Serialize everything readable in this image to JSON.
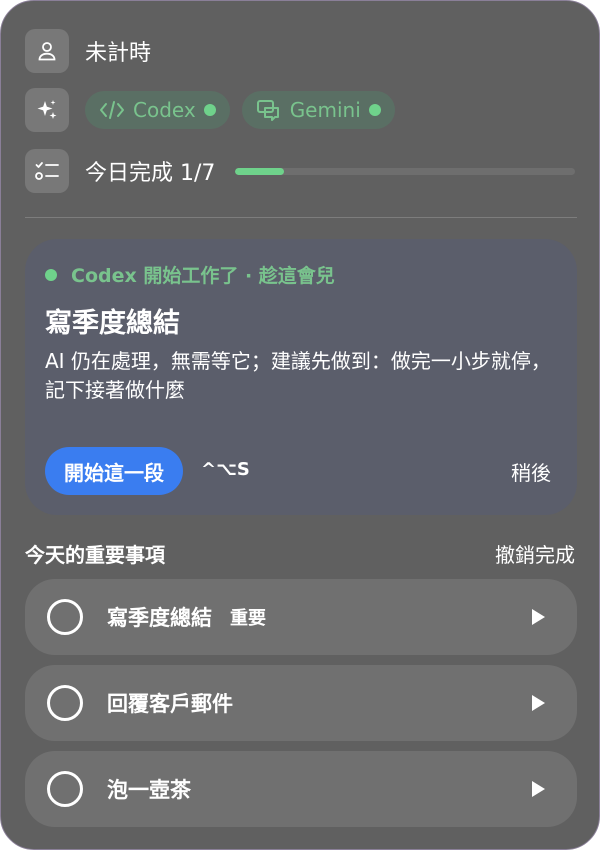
{
  "status": {
    "label": "未計時",
    "icon": "user-icon"
  },
  "agents": [
    {
      "name": "Codex",
      "icon": "code-icon",
      "active": true
    },
    {
      "name": "Gemini",
      "icon": "chat-icon",
      "active": true
    }
  ],
  "progress": {
    "label": "今日完成 1/7",
    "done": 1,
    "total": 7,
    "icon": "checklist-icon"
  },
  "focus_card": {
    "status": "Codex 開始工作了 · 趁這會兒",
    "title": "寫季度總結",
    "description": "AI 仍在處理，無需等它；建議先做到：做完一小步就停，記下接著做什麼",
    "start_label": "開始這一段",
    "shortcut": "^⌥S",
    "later_label": "稍後"
  },
  "tasks_section": {
    "title": "今天的重要事項",
    "undo_label": "撤銷完成",
    "items": [
      {
        "title": "寫季度總結",
        "tag": "重要"
      },
      {
        "title": "回覆客戶郵件",
        "tag": ""
      },
      {
        "title": "泡一壺茶",
        "tag": ""
      }
    ]
  },
  "colors": {
    "accent_green": "#6fd28b",
    "primary_blue": "#3a7df0",
    "panel_bg": "#606060",
    "card_bg": "#5b5e6b"
  }
}
